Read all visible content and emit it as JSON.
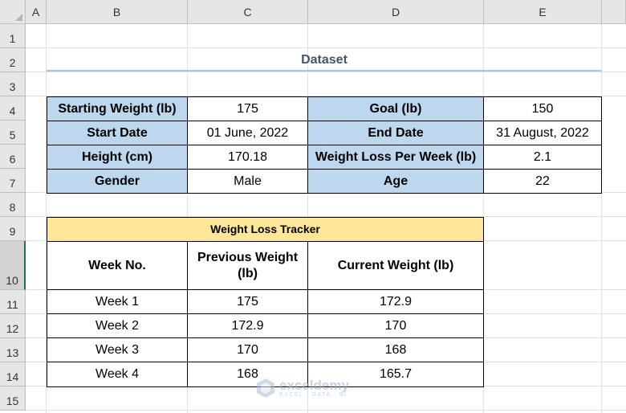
{
  "columns": [
    "A",
    "B",
    "C",
    "D",
    "E"
  ],
  "rows": [
    "1",
    "2",
    "3",
    "4",
    "5",
    "6",
    "7",
    "8",
    "9",
    "10",
    "11",
    "12",
    "13",
    "14",
    "15"
  ],
  "title": "Dataset",
  "info": {
    "starting_weight_label": "Starting Weight (lb)",
    "starting_weight_value": "175",
    "goal_label": "Goal (lb)",
    "goal_value": "150",
    "start_date_label": "Start Date",
    "start_date_value": "01 June, 2022",
    "end_date_label": "End Date",
    "end_date_value": "31 August, 2022",
    "height_label": "Height (cm)",
    "height_value": "170.18",
    "loss_per_week_label": "Weight Loss Per Week (lb)",
    "loss_per_week_value": "2.1",
    "gender_label": "Gender",
    "gender_value": "Male",
    "age_label": "Age",
    "age_value": "22"
  },
  "tracker": {
    "title": "Weight Loss Tracker",
    "headers": [
      "Week No.",
      "Previous Weight (lb)",
      "Current Weight (lb)"
    ],
    "rows": [
      [
        "Week 1",
        "175",
        "172.9"
      ],
      [
        "Week 2",
        "172.9",
        "170"
      ],
      [
        "Week 3",
        "170",
        "168"
      ],
      [
        "Week 4",
        "168",
        "165.7"
      ]
    ]
  },
  "watermark": {
    "name": "exceldemy",
    "tagline": "EXCEL · DATA · BI",
    "icon": "exceldemy-logo-icon"
  },
  "colors": {
    "label_fill": "#bdd7ee",
    "tracker_fill": "#ffe699",
    "title_color": "#44546a",
    "selected_row_accent": "#217346"
  }
}
